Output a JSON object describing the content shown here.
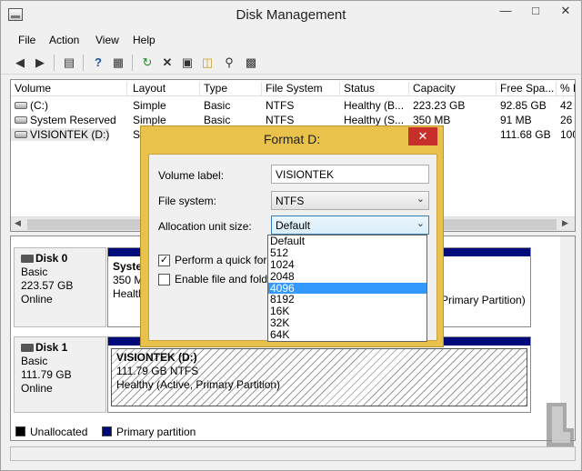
{
  "window": {
    "title": "Disk Management"
  },
  "menu": [
    "File",
    "Action",
    "View",
    "Help"
  ],
  "volume_list": {
    "columns": [
      "Volume",
      "Layout",
      "Type",
      "File System",
      "Status",
      "Capacity",
      "Free Spa...",
      "% F"
    ],
    "rows": [
      [
        "(C:)",
        "Simple",
        "Basic",
        "NTFS",
        "Healthy (B...",
        "223.23 GB",
        "92.85 GB",
        "42"
      ],
      [
        "System Reserved",
        "Simple",
        "Basic",
        "NTFS",
        "Healthy (S...",
        "350 MB",
        "91 MB",
        "26"
      ],
      [
        "VISIONTEK (D:)",
        "Si",
        "",
        "",
        "",
        "",
        "111.68 GB",
        "100"
      ]
    ]
  },
  "disks": [
    {
      "name": "Disk 0",
      "type": "Basic",
      "size": "223.57 GB",
      "status": "Online",
      "partition": {
        "name": "Syste",
        "line2": "350 M",
        "line3": "Healtl",
        "right_text": "Primary Partition)"
      }
    },
    {
      "name": "Disk 1",
      "type": "Basic",
      "size": "111.79 GB",
      "status": "Online",
      "partition": {
        "name": "VISIONTEK  (D:)",
        "line2": "111.79 GB NTFS",
        "line3": "Healthy (Active, Primary Partition)"
      }
    }
  ],
  "legend": {
    "unallocated": "Unallocated",
    "primary": "Primary partition",
    "unallocated_color": "#000000",
    "primary_color": "#000a7a"
  },
  "dialog": {
    "title": "Format D:",
    "volume_label": {
      "label": "Volume label:",
      "value": "VISIONTEK"
    },
    "file_system": {
      "label": "File system:",
      "value": "NTFS"
    },
    "allocation": {
      "label": "Allocation unit size:",
      "value": "Default"
    },
    "quick_format": {
      "label": "Perform a quick format",
      "checked": true
    },
    "compression": {
      "label": "Enable file and folder c",
      "checked": false
    },
    "options": [
      "Default",
      "512",
      "1024",
      "2048",
      "4096",
      "8192",
      "16K",
      "32K",
      "64K"
    ],
    "highlighted_option": "4096"
  },
  "watermark": {
    "text": "LEGIT REVIEWS"
  }
}
